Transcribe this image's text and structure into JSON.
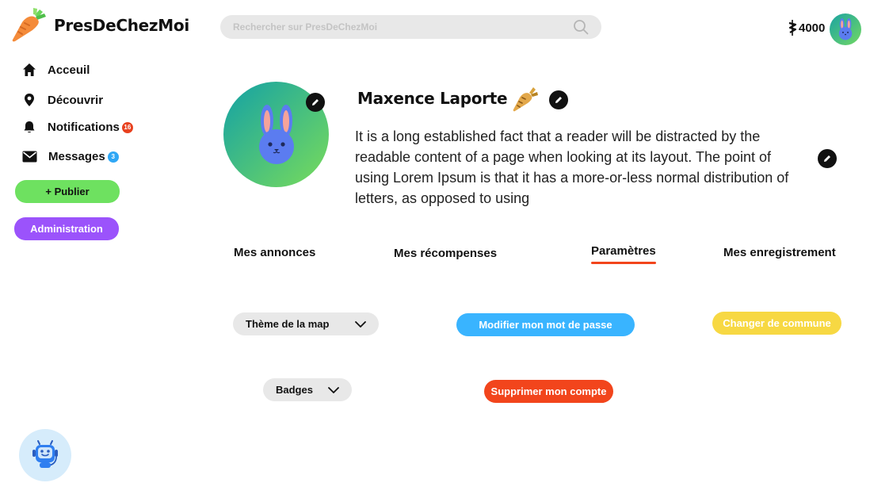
{
  "app": {
    "name": "PresDeChezMoi"
  },
  "search": {
    "placeholder": "Rechercher sur PresDeChezMoi"
  },
  "header": {
    "coins": "4000"
  },
  "sidebar": {
    "items": [
      {
        "label": "Acceuil",
        "icon": "home-icon"
      },
      {
        "label": "Découvrir",
        "icon": "location-pin-icon"
      },
      {
        "label": "Notifications",
        "icon": "bell-icon",
        "badge": "16"
      },
      {
        "label": "Messages",
        "icon": "envelope-icon",
        "badge": "3"
      }
    ],
    "publish_label": "+ Publier",
    "admin_label": "Administration"
  },
  "profile": {
    "name": "Maxence Laporte",
    "bio": "It is a long established fact that a reader will be distracted by the readable content of a page when looking at its layout. The point of using Lorem Ipsum is that it has a more-or-less normal distribution of letters, as opposed to using"
  },
  "tabs": [
    {
      "label": "Mes annonces"
    },
    {
      "label": "Mes récompenses"
    },
    {
      "label": "Paramètres",
      "active": true
    },
    {
      "label": "Mes enregistrement"
    }
  ],
  "settings": {
    "map_theme_label": "Thème de la map",
    "badges_label": "Badges",
    "change_password_label": "Modifier mon mot de passe",
    "change_commune_label": "Changer de commune",
    "delete_account_label": "Supprimer mon compte"
  },
  "colors": {
    "publish": "#6ee160",
    "admin": "#9b53fb",
    "password": "#39b4ff",
    "commune": "#f7d843",
    "delete": "#f2451c",
    "notif_badge": "#e8411f",
    "msg_badge": "#2fa7f5",
    "tab_underline": "#f2451c"
  }
}
